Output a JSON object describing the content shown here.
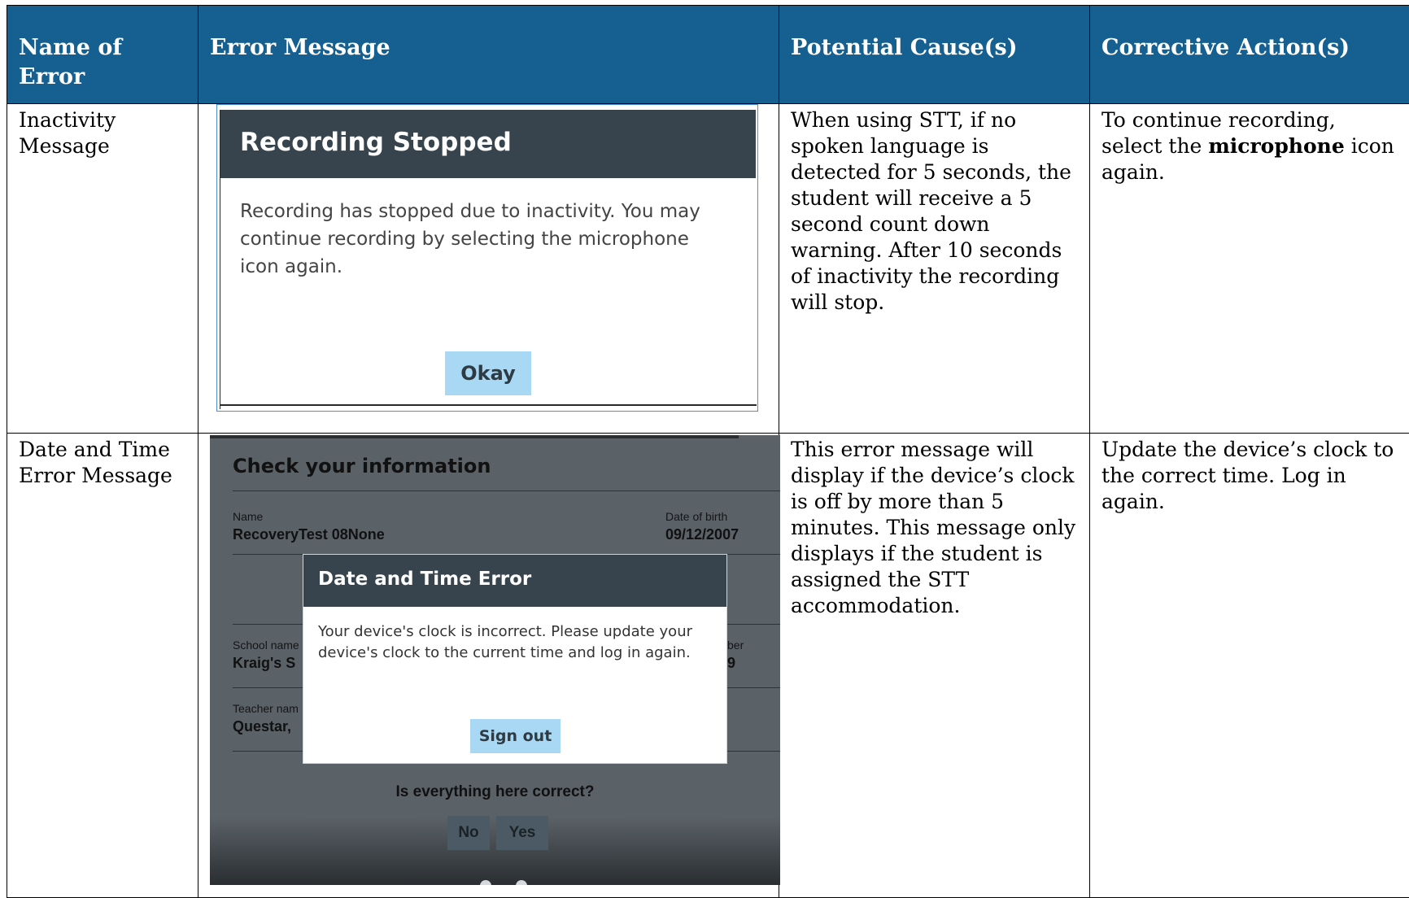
{
  "headers": {
    "name_of_error": "Name of Error",
    "error_message": "Error Message",
    "potential_causes": "Potential Cause(s)",
    "corrective_actions": "Corrective Action(s)"
  },
  "rows": [
    {
      "name": "Inactivity Message",
      "cause": "When using STT, if no spoken language is detected for 5 seconds, the student will receive a 5 second count down warning. After 10 seconds of inactivity the recording will stop.",
      "action_prefix": "To continue recording, select the ",
      "action_bold": "microphone",
      "action_suffix": " icon again.",
      "screenshot": {
        "title": "Recording Stopped",
        "body": "Recording has stopped due to inactivity. You may continue recording by selecting the microphone icon again.",
        "button": "Okay"
      }
    },
    {
      "name": "Date and Time Error Message",
      "cause": "This error message will display if the device’s clock is off by more than 5 minutes. This message only displays if the student is assigned the STT accommodation.",
      "action": "Update the device’s clock to the correct time. Log in again.",
      "screenshot": {
        "page_title": "Check your information",
        "name_label": "Name",
        "name_value": "RecoveryTest 08None",
        "dob_label": "Date of birth",
        "dob_value": "09/12/2007",
        "school_label": "School name",
        "school_value": "Kraig's S",
        "number_label": "ber",
        "number_value": "9",
        "teacher_label": "Teacher nam",
        "teacher_value": "Questar, ",
        "question": "Is everything here correct?",
        "no_button": "No",
        "yes_button": "Yes",
        "modal_title": "Date and Time Error",
        "modal_message": "Your device's clock is incorrect. Please update your device's clock to the current time and log in again.",
        "modal_button": "Sign out"
      }
    }
  ],
  "colors": {
    "header_bg": "#155f91",
    "dialog_header": "#37444d",
    "button_bg": "#a9d8f5"
  }
}
